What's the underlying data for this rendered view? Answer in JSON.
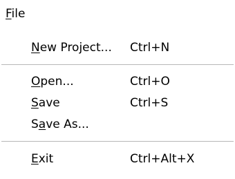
{
  "menu": {
    "title": {
      "mnemonic": "F",
      "rest": "ile"
    },
    "items": [
      {
        "mnemonic": "N",
        "rest": "ew Project...",
        "shortcut": "Ctrl+N"
      },
      {
        "mnemonic": "O",
        "rest": "pen...",
        "shortcut": "Ctrl+O"
      },
      {
        "mnemonic": "S",
        "rest": "ave",
        "shortcut": "Ctrl+S"
      },
      {
        "pre": "S",
        "mnemonic": "a",
        "rest": "ve As...",
        "shortcut": ""
      },
      {
        "mnemonic": "E",
        "rest": "xit",
        "shortcut": "Ctrl+Alt+X"
      }
    ]
  }
}
